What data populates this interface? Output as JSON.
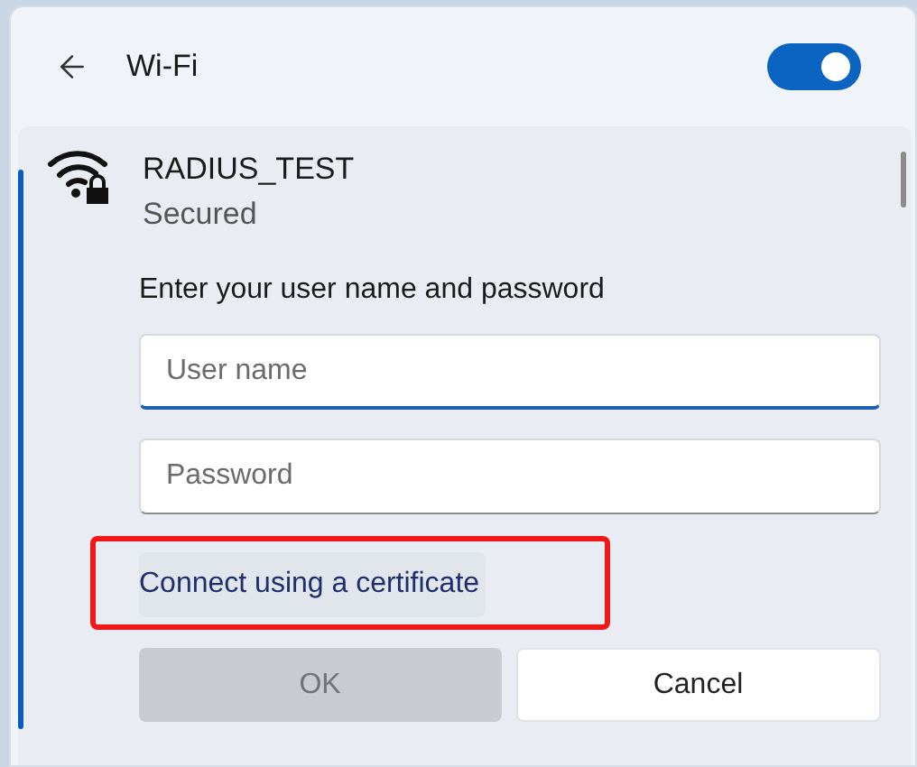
{
  "header": {
    "title": "Wi-Fi",
    "on": true
  },
  "network": {
    "name": "RADIUS_TEST",
    "status": "Secured",
    "prompt": "Enter your user name and password",
    "fields": [
      {
        "placeholder": "User name",
        "focused": true
      },
      {
        "placeholder": "Password",
        "focused": false
      }
    ],
    "certificate_link": {
      "label": "Connect using a certificate",
      "highlighted": true
    },
    "buttons": [
      {
        "label": "OK",
        "disabled": true
      },
      {
        "label": "Cancel",
        "disabled": false
      }
    ]
  }
}
